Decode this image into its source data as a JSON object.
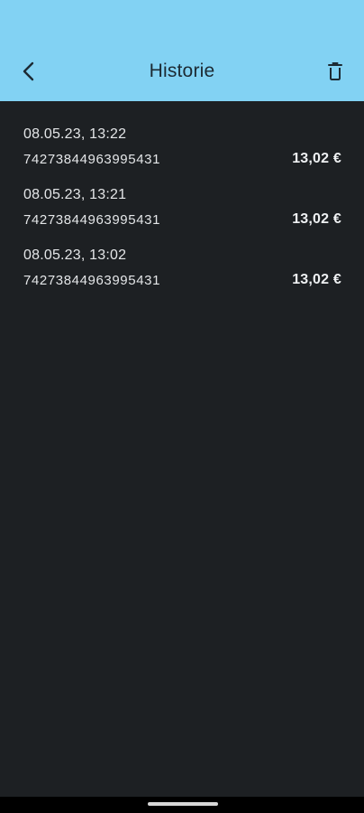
{
  "header": {
    "title": "Historie",
    "back_icon": "arrow-back-icon",
    "delete_icon": "trash-icon",
    "background_color": "#82d2f3"
  },
  "history": [
    {
      "date": "08.05.23, 13:22",
      "number": "74273844963995431",
      "amount": "13,02 €"
    },
    {
      "date": "08.05.23, 13:21",
      "number": "74273844963995431",
      "amount": "13,02 €"
    },
    {
      "date": "08.05.23, 13:02",
      "number": "74273844963995431",
      "amount": "13,02 €"
    }
  ],
  "theme": {
    "background": "#1d2023",
    "text": "#e4e6e8"
  }
}
